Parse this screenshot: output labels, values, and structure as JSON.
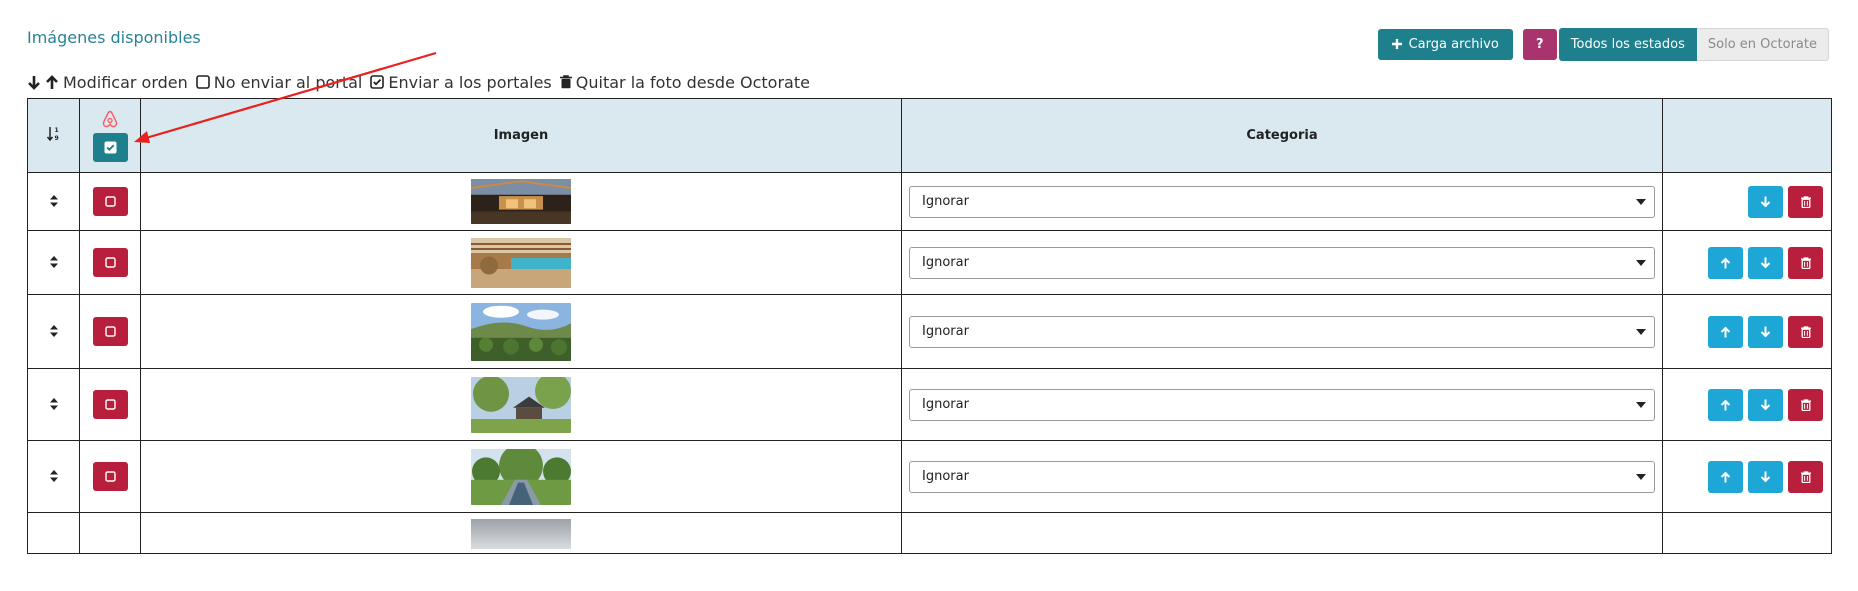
{
  "header": {
    "title": "Imágenes disponibles",
    "upload_label": "Carga archivo",
    "help_label": "?",
    "filter_all": "Todos los estados",
    "filter_octorate": "Solo en Octorate"
  },
  "legend": {
    "order_label": "Modificar orden",
    "no_send_label": "No enviar al portal",
    "send_label": "Enviar a los portales",
    "remove_label": "Quitar la foto desde Octorate"
  },
  "table": {
    "col_image": "Imagen",
    "col_category": "Categoria",
    "rows": [
      {
        "image": "rustic-pergola-evening",
        "category": "Ignorar",
        "row_height": 58,
        "has_up": false
      },
      {
        "image": "indoor-pool-wooden-hall",
        "category": "Ignorar",
        "row_height": 64,
        "has_up": true
      },
      {
        "image": "topiary-garden-hills",
        "category": "Ignorar",
        "row_height": 74,
        "has_up": true
      },
      {
        "image": "garden-house-trees",
        "category": "Ignorar",
        "row_height": 72,
        "has_up": true
      },
      {
        "image": "formal-garden-pond",
        "category": "Ignorar",
        "row_height": 72,
        "has_up": true
      }
    ]
  },
  "colors": {
    "teal": "#1e7f8d",
    "magenta": "#a8336d",
    "red": "#b81f3c",
    "blue": "#1ea6d6",
    "header_bg": "#d9e9ef",
    "airbnb": "#ff5a5f"
  }
}
